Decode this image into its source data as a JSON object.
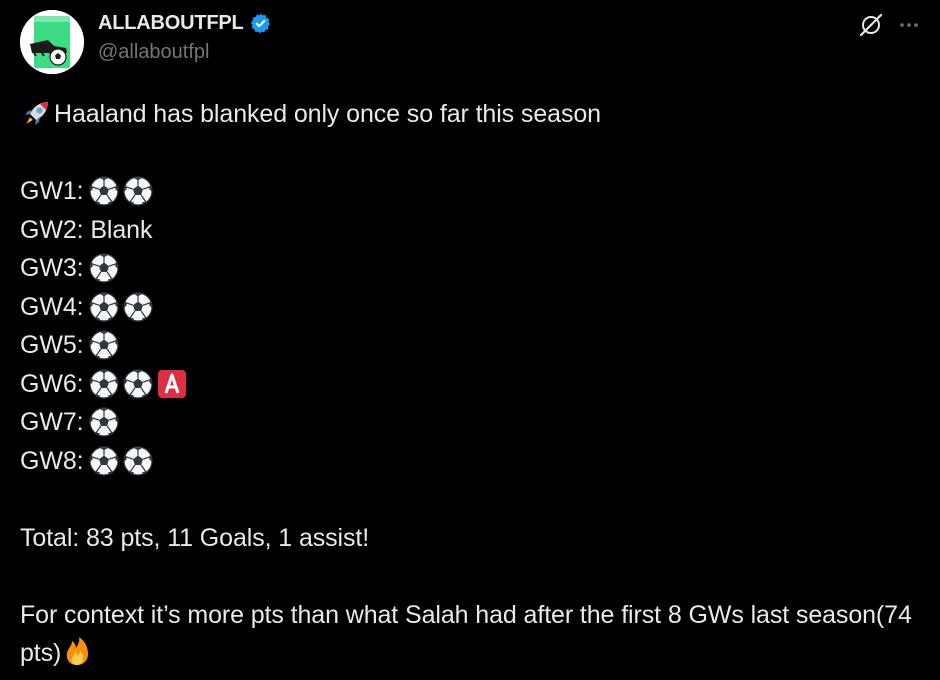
{
  "account": {
    "display_name": "ALLABOUTFPL",
    "handle": "@allaboutfpl",
    "verified": true,
    "verified_color": "#1d9bf0",
    "avatar_icon": "football-boot-avatar"
  },
  "actions": {
    "grok_icon": "grok-icon",
    "more_label": "···"
  },
  "tweet": {
    "headline_emoji": "rocket",
    "headline": "Haaland has blanked only once so far this season",
    "gameweeks": [
      {
        "label": "GW1:",
        "text": "",
        "goals": 2,
        "assist": 0
      },
      {
        "label": "GW2:",
        "text": " Blank",
        "goals": 0,
        "assist": 0
      },
      {
        "label": "GW3:",
        "text": "",
        "goals": 1,
        "assist": 0
      },
      {
        "label": "GW4:",
        "text": "",
        "goals": 2,
        "assist": 0
      },
      {
        "label": "GW5:",
        "text": "",
        "goals": 1,
        "assist": 0
      },
      {
        "label": "GW6:",
        "text": "",
        "goals": 2,
        "assist": 1
      },
      {
        "label": "GW7:",
        "text": "",
        "goals": 1,
        "assist": 0
      },
      {
        "label": "GW8:",
        "text": "",
        "goals": 2,
        "assist": 0
      }
    ],
    "total": "Total: 83 pts, 11 Goals, 1 assist!",
    "context": "For context it’s more pts than what Salah had after the first 8 GWs last season(74 pts)",
    "context_emoji": "fire"
  },
  "colors": {
    "background": "#000000",
    "text": "#e7e9ea",
    "secondary_text": "#71767b",
    "assist_badge": "#dd2e44"
  }
}
